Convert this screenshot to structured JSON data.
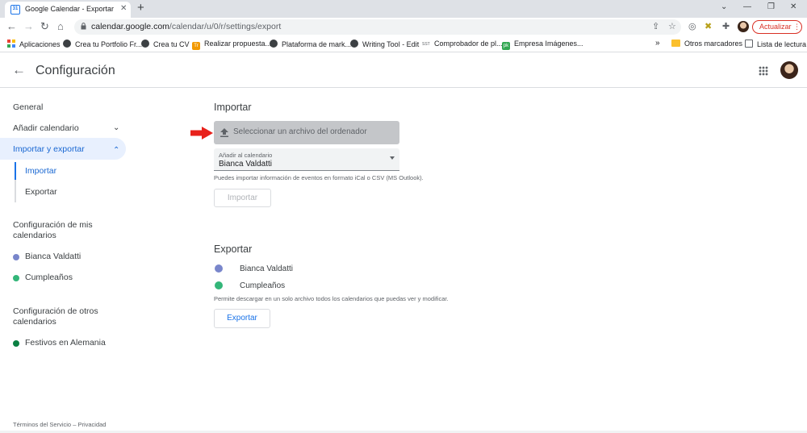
{
  "browser": {
    "tab_title": "Google Calendar - Exportar e imp",
    "url_host": "calendar.google.com",
    "url_path": "/calendar/u/0/r/settings/export",
    "update_label": "Actualizar",
    "tab_favicon_text": "31"
  },
  "bookmarks": {
    "items": [
      {
        "label": "Aplicaciones",
        "icon": "apps-grid-icon"
      },
      {
        "label": "Crea tu Portfolio Fr...",
        "icon": "globe-icon"
      },
      {
        "label": "Crea tu CV",
        "icon": "globe-icon"
      },
      {
        "label": "Realizar propuesta...",
        "icon": "orange-app-icon"
      },
      {
        "label": "Plataforma de mark...",
        "icon": "globe-icon"
      },
      {
        "label": "Writing Tool - Edit",
        "icon": "globe-icon"
      },
      {
        "label": "Comprobador de pl...",
        "icon": "sst-icon"
      },
      {
        "label": "Empresa Imágenes...",
        "icon": "green-app-icon"
      }
    ],
    "overflow": "»",
    "other_folder": "Otros marcadores",
    "reading_list": "Lista de lectura",
    "sst_text": "SST",
    "orange_text": "Tr",
    "green_text": "pk"
  },
  "header": {
    "title": "Configuración"
  },
  "sidebar": {
    "general": "General",
    "add_calendar": "Añadir calendario",
    "import_export": "Importar y exportar",
    "import": "Importar",
    "export": "Exportar",
    "my_calendars_heading_1": "Configuración de mis",
    "my_calendars_heading_2": "calendarios",
    "my_calendars": [
      {
        "label": "Bianca Valdatti",
        "color": "#7986cb"
      },
      {
        "label": "Cumpleaños",
        "color": "#33b679"
      }
    ],
    "other_calendars_heading_1": "Configuración de otros",
    "other_calendars_heading_2": "calendarios",
    "other_calendars": [
      {
        "label": "Festivos en Alemania",
        "color": "#0b8043"
      }
    ]
  },
  "import_section": {
    "title": "Importar",
    "file_button": "Seleccionar un archivo del ordenador",
    "select_label": "Añadir al calendario",
    "select_value": "Bianca Valdatti",
    "help": "Puedes importar información de eventos en formato iCal o CSV (MS Outlook).",
    "button": "Importar"
  },
  "export_section": {
    "title": "Exportar",
    "calendars": [
      {
        "label": "Bianca Valdatti",
        "color": "#7986cb"
      },
      {
        "label": "Cumpleaños",
        "color": "#33b679"
      }
    ],
    "help": "Permite descargar en un solo archivo todos los calendarios que puedas ver y modificar.",
    "button": "Exportar"
  },
  "footer": {
    "text": "Términos del Servicio – Privacidad"
  },
  "colors": {
    "accent": "#1a73e8",
    "active_nav_bg": "#e8f0fe",
    "annotation_arrow": "#e8211b"
  }
}
